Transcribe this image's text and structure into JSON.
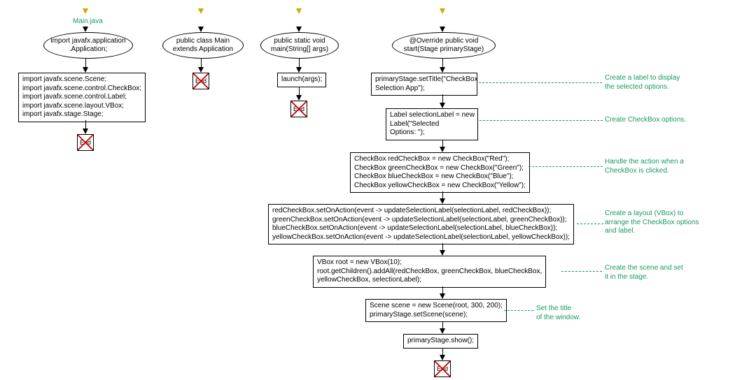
{
  "flow1": {
    "title": "Main.java",
    "e1": "import javafx.application\n.Application;",
    "n1": "import javafx.scene.Scene;\nimport javafx.scene.control.CheckBox;\nimport javafx.scene.control.Label;\nimport javafx.scene.layout.VBox;\nimport javafx.stage.Stage;"
  },
  "flow2": {
    "e1": "public class Main\nextends Application"
  },
  "flow3": {
    "e1": "public static void\nmain(String[] args)",
    "n1": "launch(args);"
  },
  "flow4": {
    "e1": "@Override public void\nstart(Stage primaryStage)",
    "n1": "primaryStage.setTitle(\"CheckBox\nSelection App\");",
    "n2": "Label selectionLabel = new\nLabel(\"Selected\nOptions: \");",
    "n3": "CheckBox redCheckBox = new CheckBox(\"Red\");\nCheckBox greenCheckBox = new CheckBox(\"Green\");\nCheckBox blueCheckBox = new CheckBox(\"Blue\");\nCheckBox yellowCheckBox = new CheckBox(\"Yellow\");",
    "n4": "redCheckBox.setOnAction(event -> updateSelectionLabel(selectionLabel, redCheckBox));\ngreenCheckBox.setOnAction(event -> updateSelectionLabel(selectionLabel, greenCheckBox));\nblueCheckBox.setOnAction(event -> updateSelectionLabel(selectionLabel, blueCheckBox));\nyellowCheckBox.setOnAction(event -> updateSelectionLabel(selectionLabel, yellowCheckBox));",
    "n5": "VBox root = new VBox(10);\nroot.getChildren().addAll(redCheckBox, greenCheckBox, blueCheckBox,\nyellowCheckBox, selectionLabel);",
    "n6": "Scene scene = new Scene(root, 300, 200);\nprimaryStage.setScene(scene);",
    "n7": "primaryStage.show();"
  },
  "ann": {
    "a1": "Create a label to display\nthe selected options.",
    "a2": "Create CheckBox options.",
    "a3": "Handle the action when a\nCheckBox is clicked.",
    "a4": "Create a layout (VBox) to\narrange the CheckBox options\nand label.",
    "a5": "Create the scene and set\nit in the stage.",
    "a6": "Set the title\nof the window."
  },
  "end_label": "End"
}
